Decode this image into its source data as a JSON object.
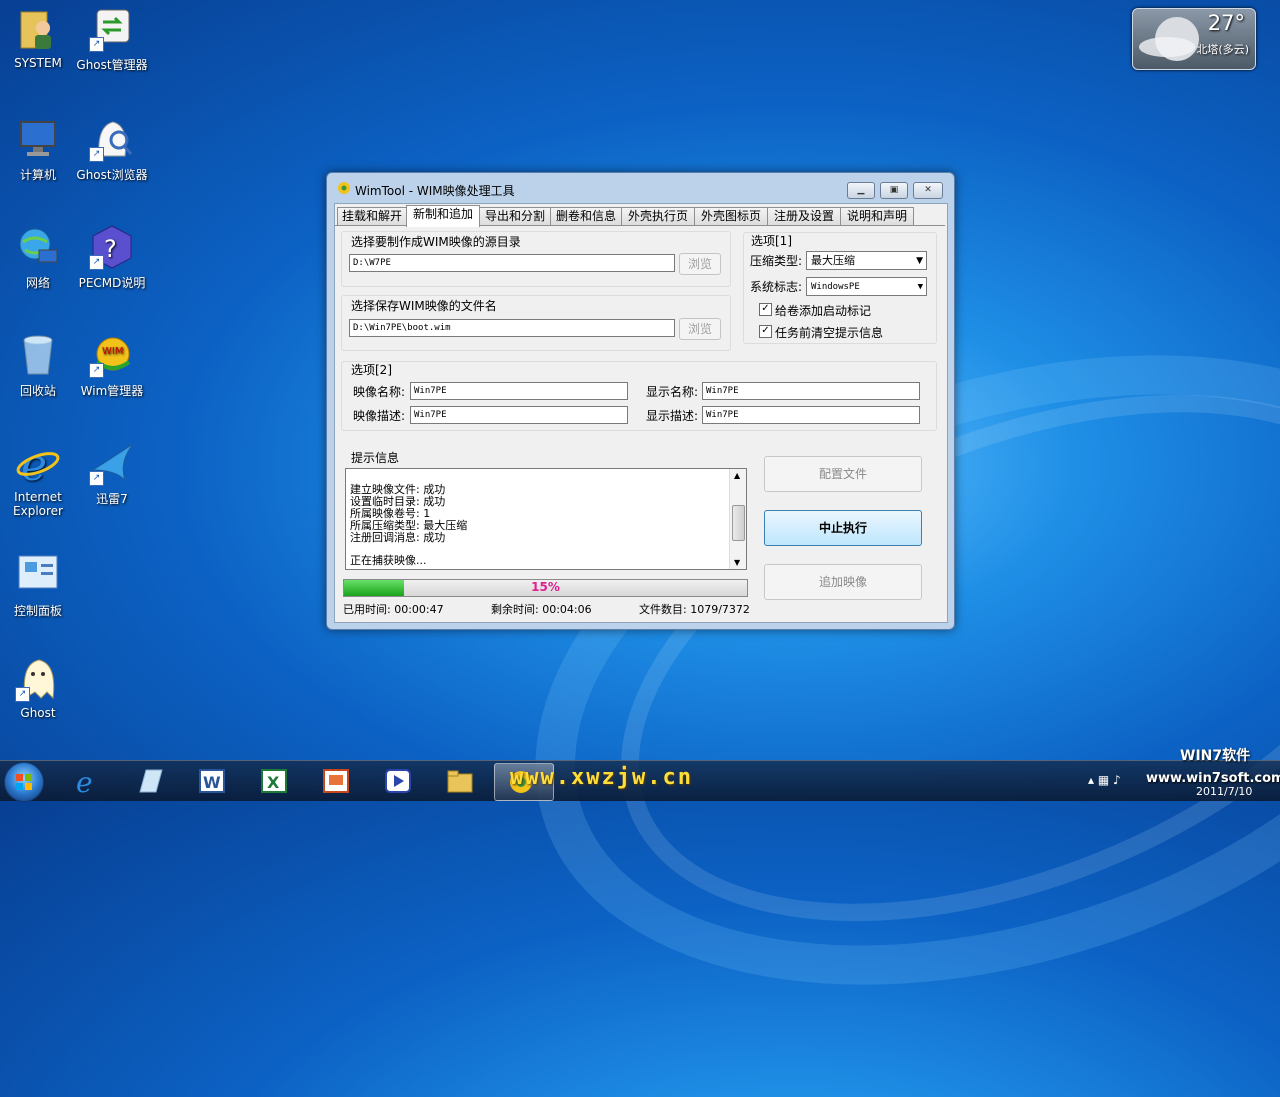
{
  "desktop": {
    "icons": [
      {
        "label": "SYSTEM"
      },
      {
        "label": "Ghost管理器"
      },
      {
        "label": "计算机"
      },
      {
        "label": "Ghost浏览器"
      },
      {
        "label": "网络"
      },
      {
        "label": "PECMD说明"
      },
      {
        "label": "回收站"
      },
      {
        "label": "Wim管理器"
      },
      {
        "label": "Internet Explorer"
      },
      {
        "label": "迅雷7"
      },
      {
        "label": "控制面板"
      },
      {
        "label": "Ghost"
      }
    ]
  },
  "gadget": {
    "temperature": "27°",
    "condition": "北塔(多云)"
  },
  "window": {
    "title": "WimTool - WIM映像处理工具",
    "tabs": [
      "挂载和解开",
      "新制和追加",
      "导出和分割",
      "删卷和信息",
      "外壳执行页",
      "外壳图标页",
      "注册及设置",
      "说明和声明"
    ],
    "active_tab": 1,
    "source": {
      "label": "选择要制作成WIM映像的源目录",
      "value": "D:\\W7PE",
      "browse": "浏览"
    },
    "target": {
      "label": "选择保存WIM映像的文件名",
      "value": "D:\\Win7PE\\boot.wim",
      "browse": "浏览"
    },
    "options1": {
      "title": "选项[1]",
      "compress_label": "压缩类型:",
      "compress_value": "最大压缩",
      "flag_label": "系统标志:",
      "flag_value": "WindowsPE",
      "chk_boot": "给卷添加启动标记",
      "chk_clear": "任务前清空提示信息"
    },
    "options2": {
      "title": "选项[2]",
      "image_name_label": "映像名称:",
      "image_name": "Win7PE",
      "display_name_label": "显示名称:",
      "display_name": "Win7PE",
      "image_desc_label": "映像描述:",
      "image_desc": "Win7PE",
      "display_desc_label": "显示描述:",
      "display_desc": "Win7PE"
    },
    "info": {
      "title": "提示信息",
      "lines": [
        "建立映像文件: 成功",
        "设置临时目录: 成功",
        "所属映像卷号: 1",
        "所属压缩类型: 最大压缩",
        "注册回调消息: 成功"
      ],
      "current": "正在捕获映像..."
    },
    "buttons": {
      "config": "配置文件",
      "stop": "中止执行",
      "append": "追加映像"
    },
    "progress": {
      "percent": 15,
      "label": "15%"
    },
    "status": {
      "elapsed": "已用时间: 00:00:47",
      "remaining": "剩余时间: 00:04:06",
      "files": "文件数目: 1079/7372"
    }
  },
  "taskbar": {
    "watermark": "www.xwzjw.cn",
    "brand": "WIN7软件",
    "site": "www.win7soft.com",
    "date": "2011/7/10"
  }
}
